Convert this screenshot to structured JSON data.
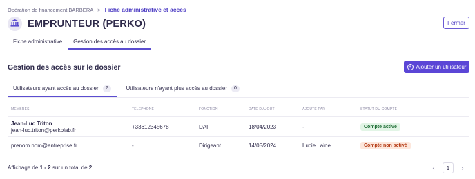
{
  "breadcrumb": {
    "parent": "Opération de financement BARBERA",
    "separator": ">",
    "current": "Fiche administrative et accès"
  },
  "header": {
    "avatar_icon": "bank-building-icon",
    "title": "EMPRUNTEUR (PERKO)",
    "close_label": "Fermer"
  },
  "tabs": [
    {
      "label": "Fiche administrative",
      "active": false
    },
    {
      "label": "Gestion des accès au dossier",
      "active": true
    }
  ],
  "section": {
    "title": "Gestion des accès sur le dossier",
    "add_button_label": "Ajouter un utilisateur",
    "add_icon": "plus-circle-icon"
  },
  "subtabs": [
    {
      "label": "Utilisateurs ayant accès au dossier",
      "count": "2",
      "active": true
    },
    {
      "label": "Utilisateurs n'ayant plus accès au dossier",
      "count": "0",
      "active": false
    }
  ],
  "table": {
    "headers": {
      "members": "MEMBRES",
      "phone": "TÉLÉPHONE",
      "function": "FONCTION",
      "date_added": "DATE D'AJOUT",
      "added_by": "AJOUTÉ PAR",
      "status": "STATUT DU COMPTE"
    },
    "rows": [
      {
        "name": "Jean-Luc Triton",
        "email": "jean-luc.triton@perkolab.fr",
        "phone": "+33612345678",
        "function": "DAF",
        "date_added": "18/04/2023",
        "added_by": "-",
        "status": "Compte activé",
        "status_kind": "active"
      },
      {
        "name": "",
        "email": "prenom.nom@entreprise.fr",
        "phone": "-",
        "function": "Dirigeant",
        "date_added": "14/05/2024",
        "added_by": "Lucie Laine",
        "status": "Compte non activé",
        "status_kind": "inactive"
      }
    ],
    "row_menu_icon": "kebab-menu-icon"
  },
  "footer": {
    "prefix": "Affichage de",
    "range": "1 - 2",
    "middle": "sur un total de",
    "total": "2"
  },
  "pagination": {
    "prev_icon": "chevron-left-icon",
    "next_icon": "chevron-right-icon",
    "current_page": "1"
  },
  "colors": {
    "accent": "#5b46d6",
    "breadcrumb_current": "#4f3fc4",
    "badge_active_bg": "#e2f5e6",
    "badge_inactive_bg": "#fde7dc"
  }
}
